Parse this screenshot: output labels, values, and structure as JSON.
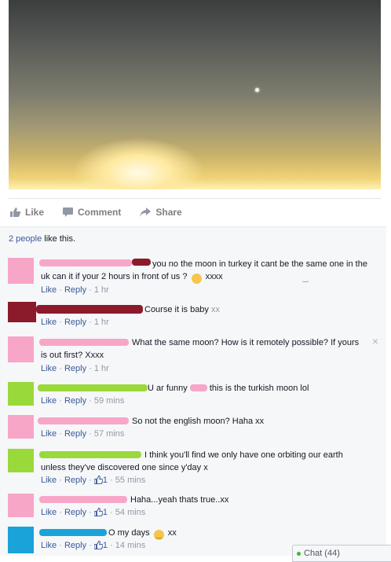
{
  "post": {
    "actions": {
      "like": "Like",
      "comment": "Comment",
      "share": "Share"
    },
    "likes": {
      "count_text": "2 people",
      "suffix": "like this."
    }
  },
  "comments": [
    {
      "text": "you no the moon in turkey it cant be the same one in the uk can it if your 2 hours in front of us ?",
      "after_emoji": "xxxx",
      "like": "Like",
      "reply": "Reply",
      "time": "1 hr"
    },
    {
      "text": "Course it is baby",
      "after": "xx",
      "like": "Like",
      "reply": "Reply",
      "time": "1 hr"
    },
    {
      "text": "What the same moon? How is it remotely possible? If yours is out first? Xxxx",
      "like": "Like",
      "reply": "Reply",
      "time": "1 hr"
    },
    {
      "text": "U ar funny",
      "after": "this is the turkish moon lol",
      "like": "Like",
      "reply": "Reply",
      "time": "59 mins"
    },
    {
      "text": "So not the english moon? Haha xx",
      "like": "Like",
      "reply": "Reply",
      "time": "57 mins"
    },
    {
      "text": "I think you'll find we only have one orbiting our earth unless they've discovered one since y'day x",
      "like": "Like",
      "reply": "Reply",
      "likes": "1",
      "time": "55 mins"
    },
    {
      "text": "Haha...yeah thats true..xx",
      "like": "Like",
      "reply": "Reply",
      "likes": "1",
      "time": "54 mins"
    },
    {
      "text": "O my days",
      "after_emoji": "xx",
      "like": "Like",
      "reply": "Reply",
      "likes": "1",
      "time": "14 mins"
    }
  ],
  "close_label": "×",
  "chat": {
    "label": "Chat (44)"
  },
  "colors": {
    "link": "#3b5998",
    "meta": "#9197a3",
    "pink": "#f7a6c8",
    "maroon": "#8b1a2b",
    "green": "#9ad93a",
    "blue": "#1aa3d9"
  }
}
